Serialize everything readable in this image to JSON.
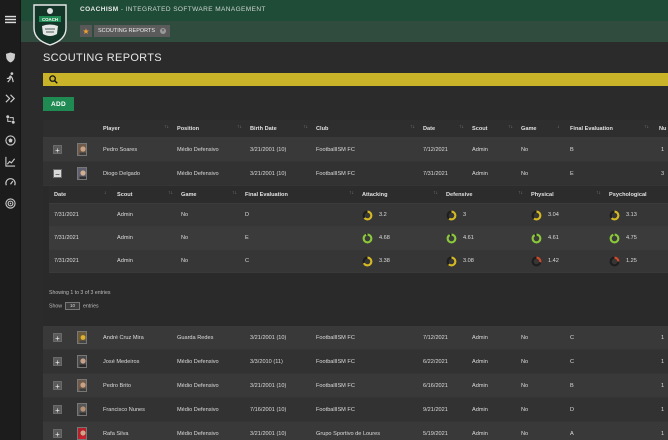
{
  "app": {
    "brand_prefix": "COACH",
    "brand_suffix": "ISM",
    "subtitle": " - INTEGRATED SOFTWARE MANAGEMENT",
    "logo_text": "COACH"
  },
  "tabs": [
    {
      "label": "SCOUTING REPORTS",
      "active": true
    }
  ],
  "page": {
    "title": "SCOUTING REPORTS",
    "search_placeholder": "",
    "add_label": "ADD"
  },
  "columns": [
    "Player",
    "Position",
    "Birth Date",
    "Club",
    "Date",
    "Scout",
    "Game",
    "Final Evaluation",
    "Nu"
  ],
  "rows": [
    {
      "player": "Pedro Soares",
      "position": "Médio Defensivo",
      "birth": "3/21/2001 (10)",
      "club": "FootballISM FC",
      "date": "7/12/2021",
      "scout": "Admin",
      "game": "No",
      "eval": "B",
      "num": "1",
      "expanded": false
    },
    {
      "player": "Diogo Delgado",
      "position": "Médio Defensivo",
      "birth": "3/21/2001 (10)",
      "club": "FootballISM FC",
      "date": "7/31/2021",
      "scout": "Admin",
      "game": "No",
      "eval": "E",
      "num": "3",
      "expanded": true
    },
    {
      "player": "André Cruz Mira",
      "position": "Guarda Redes",
      "birth": "3/21/2001 (10)",
      "club": "FootballISM FC",
      "date": "7/12/2021",
      "scout": "Admin",
      "game": "No",
      "eval": "C",
      "num": "1",
      "expanded": false
    },
    {
      "player": "José Medeiros",
      "position": "Médio Defensivo",
      "birth": "3/3/2010 (11)",
      "club": "FootballISM FC",
      "date": "6/22/2021",
      "scout": "Admin",
      "game": "No",
      "eval": "C",
      "num": "1",
      "expanded": false
    },
    {
      "player": "Pedro Brito",
      "position": "Médio Defensivo",
      "birth": "3/21/2001 (10)",
      "club": "FootballISM FC",
      "date": "6/16/2021",
      "scout": "Admin",
      "game": "No",
      "eval": "B",
      "num": "1",
      "expanded": false
    },
    {
      "player": "Francisco Nunes",
      "position": "Médio Defensivo",
      "birth": "7/16/2001 (10)",
      "club": "FootballISM FC",
      "date": "9/21/2021",
      "scout": "Admin",
      "game": "No",
      "eval": "D",
      "num": "1",
      "expanded": false
    },
    {
      "player": "Rafa Silva",
      "position": "Médio Defensivo",
      "birth": "3/21/2001 (10)",
      "club": "Grupo Sportivo de Loures",
      "date": "5/19/2021",
      "scout": "Admin",
      "game": "No",
      "eval": "A",
      "num": "1",
      "expanded": false
    }
  ],
  "nested": {
    "columns": [
      "Date",
      "Scout",
      "Game",
      "Final Evaluation",
      "Attacking",
      "Defensive",
      "Physical",
      "Psychological"
    ],
    "rows": [
      {
        "date": "7/31/2021",
        "scout": "Admin",
        "game": "No",
        "eval": "D",
        "attacking": "3.2",
        "defensive": "3",
        "physical": "3.04",
        "psychological": "3.13",
        "ring_levels": [
          0.64,
          0.6,
          0.61,
          0.63
        ],
        "ring_colors": [
          "#d4b824",
          "#d4b824",
          "#d4b824",
          "#d4b824"
        ]
      },
      {
        "date": "7/31/2021",
        "scout": "Admin",
        "game": "No",
        "eval": "E",
        "attacking": "4.68",
        "defensive": "4.61",
        "physical": "4.61",
        "psychological": "4.75",
        "ring_levels": [
          0.94,
          0.92,
          0.92,
          0.95
        ],
        "ring_colors": [
          "#8cc83c",
          "#8cc83c",
          "#8cc83c",
          "#8cc83c"
        ]
      },
      {
        "date": "7/31/2021",
        "scout": "Admin",
        "game": "No",
        "eval": "C",
        "attacking": "3.38",
        "defensive": "3.08",
        "physical": "1.42",
        "psychological": "1.25",
        "ring_levels": [
          0.68,
          0.62,
          0.28,
          0.25
        ],
        "ring_colors": [
          "#d4b824",
          "#d4b824",
          "#d24a2c",
          "#d24a2c"
        ]
      }
    ],
    "info": "Showing 1 to 3 of 3 entries",
    "show_label": "Show",
    "show_value": "10",
    "entries_label": "entries"
  },
  "colors": {
    "header_green": "#1e4c37",
    "accent_green": "#1f8a52",
    "search_yellow": "#c8b329"
  }
}
